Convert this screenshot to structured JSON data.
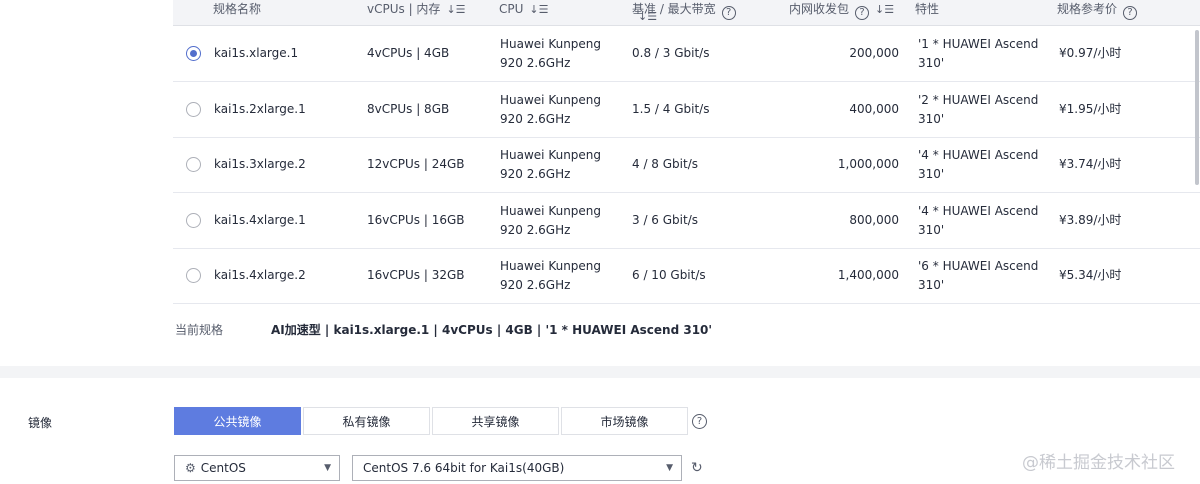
{
  "table": {
    "headers": {
      "name": "规格名称",
      "vcpu_mem": "vCPUs | 内存",
      "cpu": "CPU",
      "bandwidth": "基准 / 最大带宽",
      "pps": "内网收发包",
      "features": "特性",
      "price": "规格参考价"
    },
    "rows": [
      {
        "selected": true,
        "name": "kai1s.xlarge.1",
        "vcpu_mem": "4vCPUs | 4GB",
        "cpu_l1": "Huawei Kunpeng",
        "cpu_l2": "920 2.6GHz",
        "bandwidth": "0.8 / 3 Gbit/s",
        "pps": "200,000",
        "feat_l1": "'1 * HUAWEI Ascend",
        "feat_l2": "310'",
        "price": "¥0.97/小时"
      },
      {
        "selected": false,
        "name": "kai1s.2xlarge.1",
        "vcpu_mem": "8vCPUs | 8GB",
        "cpu_l1": "Huawei Kunpeng",
        "cpu_l2": "920 2.6GHz",
        "bandwidth": "1.5 / 4 Gbit/s",
        "pps": "400,000",
        "feat_l1": "'2 * HUAWEI Ascend",
        "feat_l2": "310'",
        "price": "¥1.95/小时"
      },
      {
        "selected": false,
        "name": "kai1s.3xlarge.2",
        "vcpu_mem": "12vCPUs | 24GB",
        "cpu_l1": "Huawei Kunpeng",
        "cpu_l2": "920 2.6GHz",
        "bandwidth": "4 / 8 Gbit/s",
        "pps": "1,000,000",
        "feat_l1": "'4 * HUAWEI Ascend",
        "feat_l2": "310'",
        "price": "¥3.74/小时"
      },
      {
        "selected": false,
        "name": "kai1s.4xlarge.1",
        "vcpu_mem": "16vCPUs | 16GB",
        "cpu_l1": "Huawei Kunpeng",
        "cpu_l2": "920 2.6GHz",
        "bandwidth": "3 / 6 Gbit/s",
        "pps": "800,000",
        "feat_l1": "'4 * HUAWEI Ascend",
        "feat_l2": "310'",
        "price": "¥3.89/小时"
      },
      {
        "selected": false,
        "name": "kai1s.4xlarge.2",
        "vcpu_mem": "16vCPUs | 32GB",
        "cpu_l1": "Huawei Kunpeng",
        "cpu_l2": "920 2.6GHz",
        "bandwidth": "6 / 10 Gbit/s",
        "pps": "1,400,000",
        "feat_l1": "'6 * HUAWEI Ascend",
        "feat_l2": "310'",
        "price": "¥5.34/小时"
      }
    ]
  },
  "current_spec": {
    "label": "当前规格",
    "value": "AI加速型 | kai1s.xlarge.1 | 4vCPUs | 4GB | '1 * HUAWEI Ascend 310'"
  },
  "image": {
    "label": "镜像",
    "tabs": [
      "公共镜像",
      "私有镜像",
      "共享镜像",
      "市场镜像"
    ],
    "os_select": "CentOS",
    "version_select": "CentOS 7.6 64bit for Kai1s(40GB)"
  },
  "watermark": "@稀土掘金技术社区",
  "colors": {
    "primary": "#5e7ce0",
    "radio": "#526ecc"
  },
  "icons": {
    "sort": "sort-icon",
    "help": "question-circle-icon",
    "gear": "gear-icon",
    "refresh": "refresh-icon",
    "caret": "caret-down-icon"
  }
}
